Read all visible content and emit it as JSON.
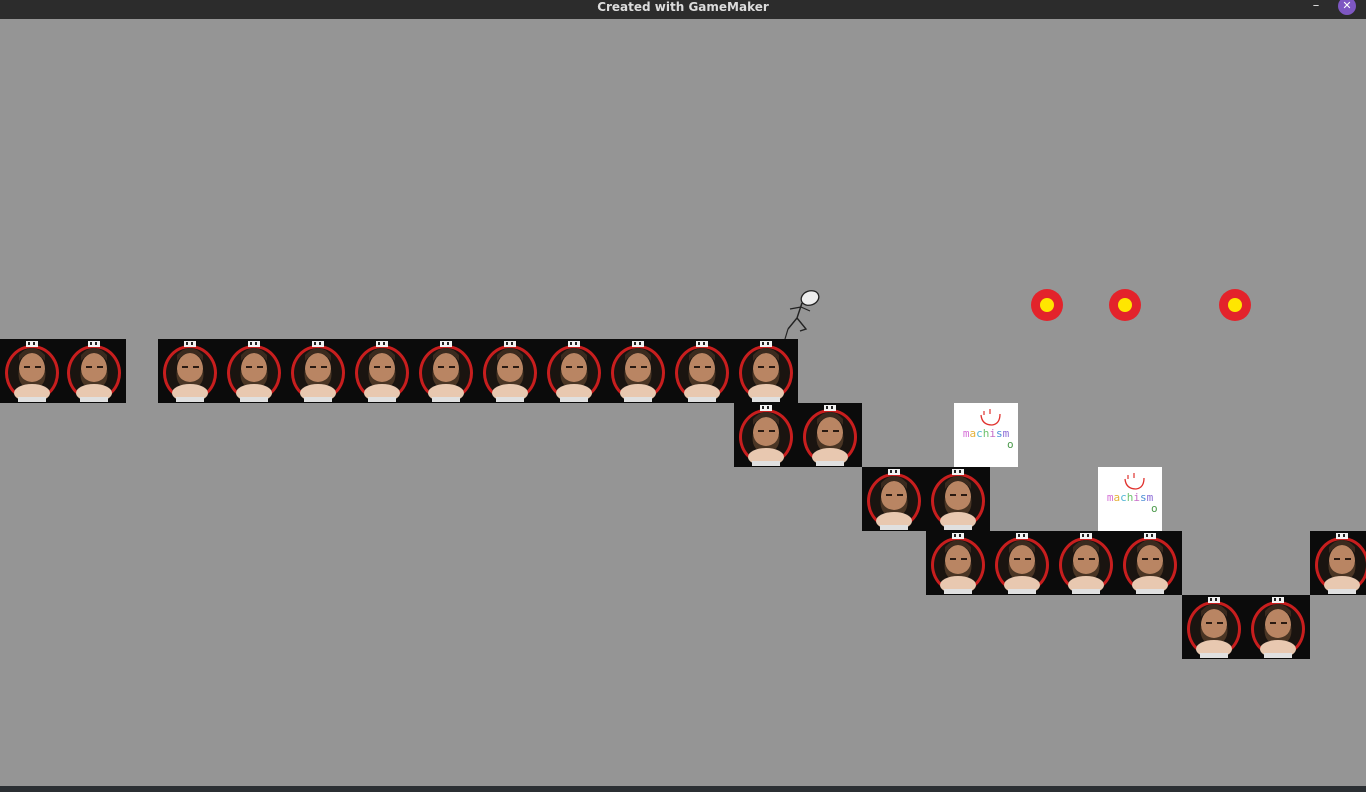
{
  "window": {
    "title": "Created with GameMaker",
    "minimize_label": "–",
    "close_label": "✕",
    "close_color": "#7e57c2"
  },
  "scene": {
    "background_color": "#959595",
    "tile_sprite": "bearded-man-portrait",
    "sign_text": "machism",
    "sign_trailing_letter": "o",
    "coin_outer_color": "#e3232b",
    "coin_inner_color": "#ffe600",
    "coin_count": 3,
    "player_sprite": "stick-figure"
  }
}
